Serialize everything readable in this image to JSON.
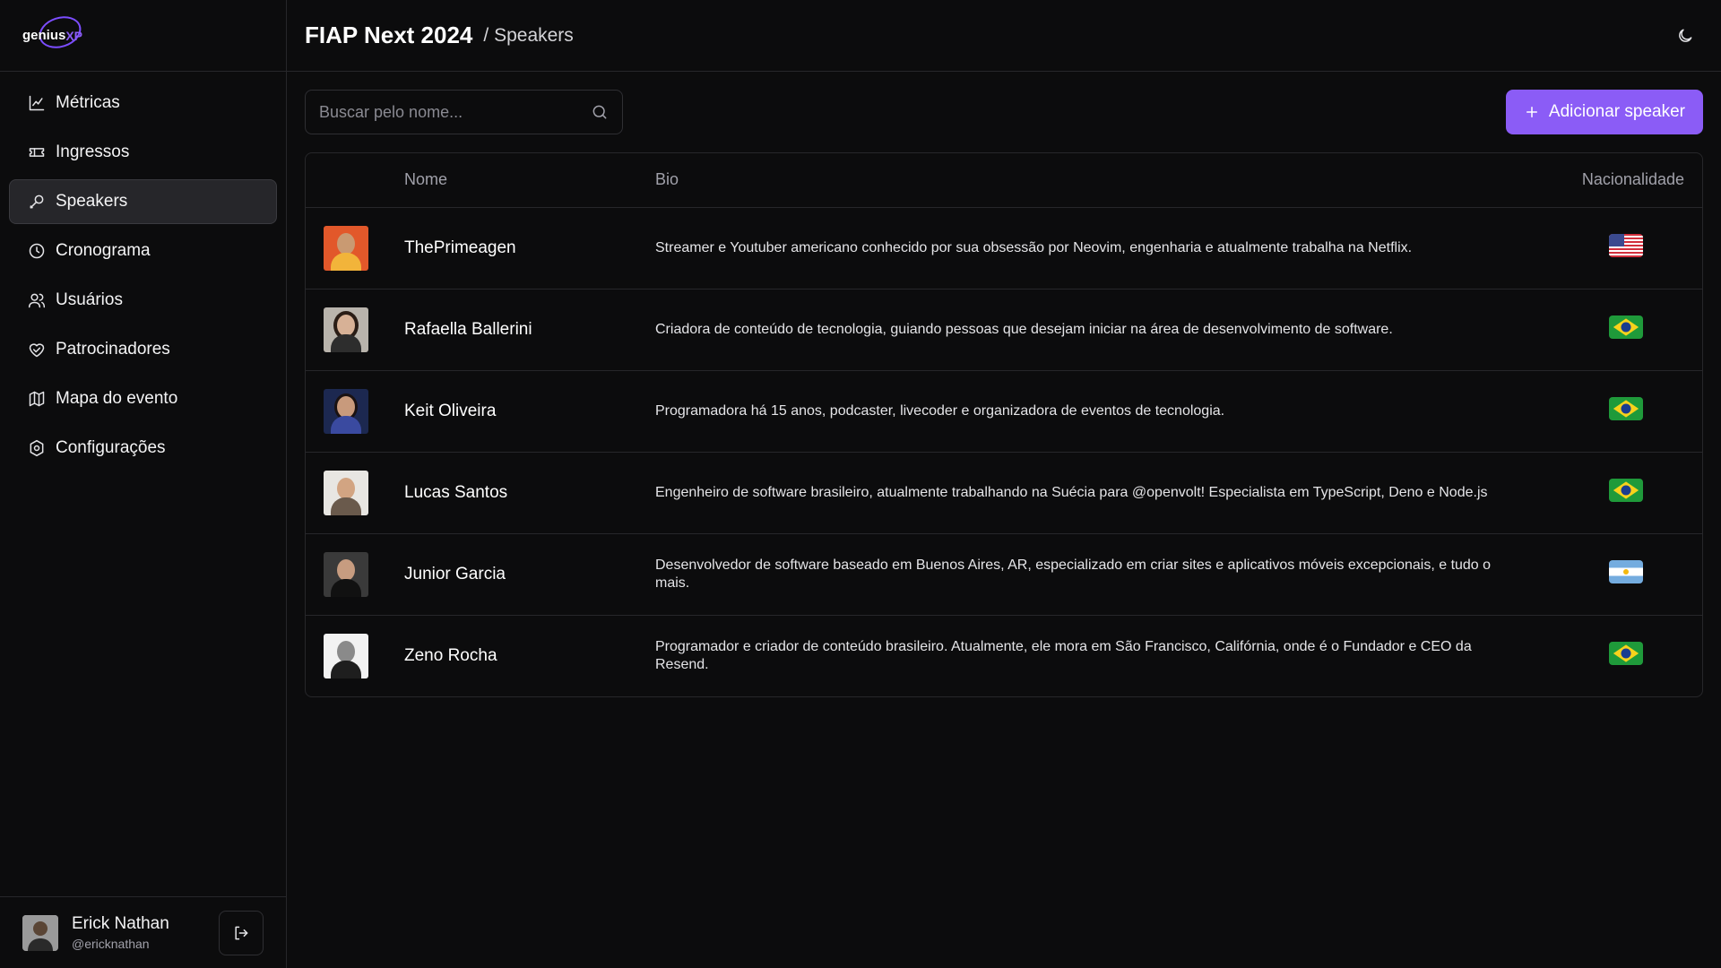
{
  "brand": {
    "logo_word1": "genius",
    "logo_word2": "XP"
  },
  "sidebar": {
    "items": [
      {
        "label": "Métricas",
        "icon": "chart-line-icon",
        "active": false
      },
      {
        "label": "Ingressos",
        "icon": "ticket-icon",
        "active": false
      },
      {
        "label": "Speakers",
        "icon": "mic-icon",
        "active": true
      },
      {
        "label": "Cronograma",
        "icon": "clock-icon",
        "active": false
      },
      {
        "label": "Usuários",
        "icon": "users-icon",
        "active": false
      },
      {
        "label": "Patrocinadores",
        "icon": "handshake-heart-icon",
        "active": false
      },
      {
        "label": "Mapa do evento",
        "icon": "map-icon",
        "active": false
      },
      {
        "label": "Configurações",
        "icon": "settings-icon",
        "active": false
      }
    ]
  },
  "user": {
    "name": "Erick Nathan",
    "handle": "@ericknathan"
  },
  "header": {
    "event_title": "FIAP Next 2024",
    "crumb": "/ Speakers"
  },
  "search": {
    "placeholder": "Buscar pelo nome..."
  },
  "actions": {
    "add_label": "Adicionar speaker"
  },
  "table": {
    "columns": {
      "name": "Nome",
      "bio": "Bio",
      "nationality": "Nacionalidade"
    },
    "rows": [
      {
        "name": "ThePrimeagen",
        "bio": "Streamer e Youtuber americano conhecido por sua obsessão por Neovim, engenharia e atualmente trabalha na Netflix.",
        "flag": "us"
      },
      {
        "name": "Rafaella Ballerini",
        "bio": "Criadora de conteúdo de tecnologia, guiando pessoas que desejam iniciar na área de desenvolvimento de software.",
        "flag": "br"
      },
      {
        "name": "Keit Oliveira",
        "bio": "Programadora há 15 anos, podcaster, livecoder e organizadora de eventos de tecnologia.",
        "flag": "br"
      },
      {
        "name": "Lucas Santos",
        "bio": "Engenheiro de software brasileiro, atualmente trabalhando na Suécia para @openvolt! Especialista em TypeScript, Deno e Node.js",
        "flag": "br"
      },
      {
        "name": "Junior Garcia",
        "bio": "Desenvolvedor de software baseado em Buenos Aires, AR, especializado em criar sites e aplicativos móveis excepcionais, e tudo o mais.",
        "flag": "ar"
      },
      {
        "name": "Zeno Rocha",
        "bio": "Programador e criador de conteúdo brasileiro. Atualmente, ele mora em São Francisco, Califórnia, onde é o Fundador e CEO da Resend.",
        "flag": "br"
      }
    ]
  },
  "colors": {
    "accent": "#8b5cf6",
    "background": "#0c0c0d",
    "border": "#27272a",
    "active_nav": "#26262a"
  }
}
